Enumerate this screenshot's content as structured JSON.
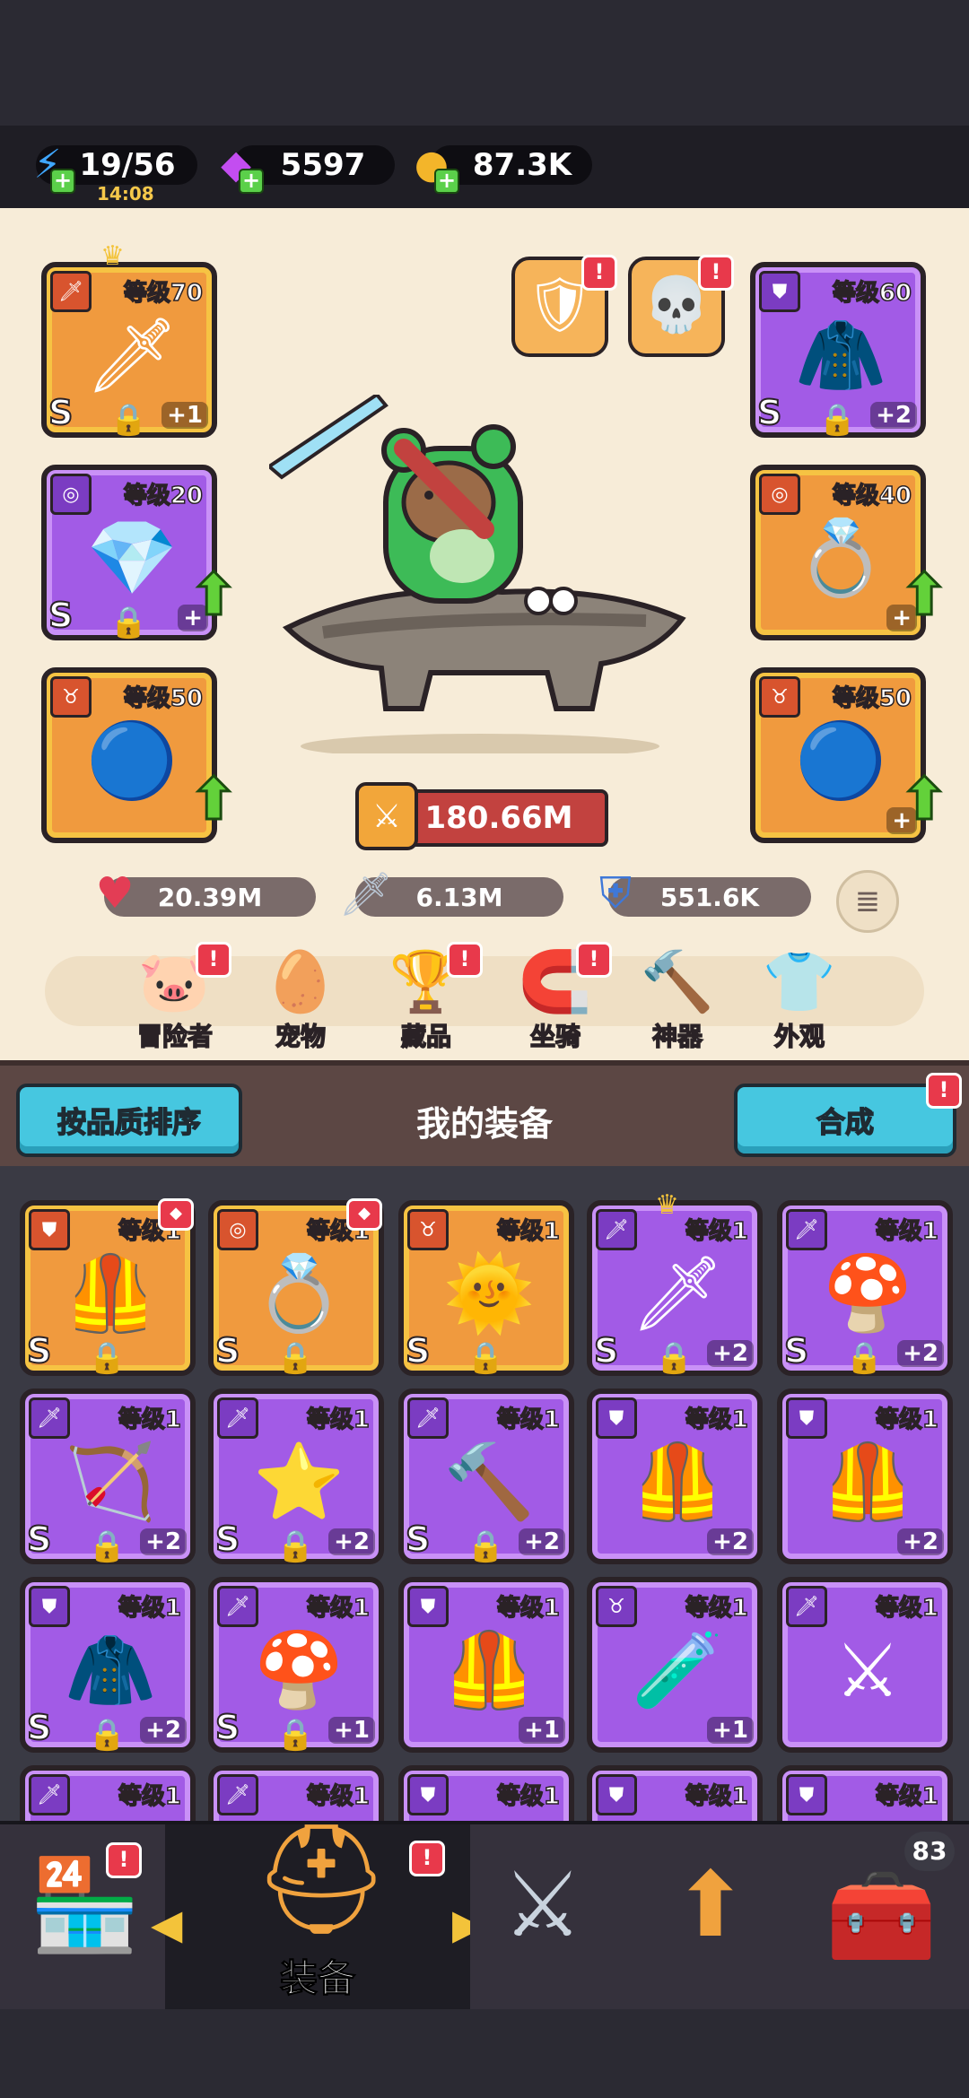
{
  "resources": {
    "energy": "19/56",
    "energy_timer": "14:08",
    "gems": "5597",
    "gold": "87.3K"
  },
  "hero": {
    "slots_left": [
      {
        "level": "等级70",
        "grade": "S",
        "plus": "+1",
        "rarity": "orange",
        "type_icon": "sword-icon",
        "art": "dark-sword"
      },
      {
        "level": "等级20",
        "grade": "S",
        "plus": "+",
        "rarity": "purple",
        "type_icon": "ring-icon",
        "art": "crystal-bracer"
      },
      {
        "level": "等级50",
        "grade": "",
        "plus": "",
        "rarity": "orange",
        "type_icon": "necklace-icon",
        "art": "blue-orb"
      }
    ],
    "slots_right": [
      {
        "level": "等级60",
        "grade": "S",
        "plus": "+2",
        "rarity": "purple",
        "type_icon": "armor-icon",
        "art": "purple-cape"
      },
      {
        "level": "等级40",
        "grade": "",
        "plus": "+",
        "rarity": "orange",
        "type_icon": "ring-icon",
        "art": "gold-ring"
      },
      {
        "level": "等级50",
        "grade": "",
        "plus": "+",
        "rarity": "orange",
        "type_icon": "necklace-icon",
        "art": "blue-orb"
      }
    ],
    "power": "180.66M",
    "hp": "20.39M",
    "attack": "6.13M",
    "defense": "551.6K"
  },
  "nav": [
    {
      "label": "冒险者",
      "icon": "pig-adventurer-icon",
      "badge": "!"
    },
    {
      "label": "宠物",
      "icon": "egg-pet-icon",
      "badge": ""
    },
    {
      "label": "藏品",
      "icon": "trophy-icon",
      "badge": "!"
    },
    {
      "label": "坐骑",
      "icon": "horseshoe-icon",
      "badge": "!"
    },
    {
      "label": "神器",
      "icon": "hammer-icon",
      "badge": ""
    },
    {
      "label": "外观",
      "icon": "outfit-icon",
      "badge": ""
    }
  ],
  "equipment": {
    "sort_label": "按品质排序",
    "title": "我的装备",
    "merge_label": "合成",
    "merge_badge": "!",
    "items": [
      {
        "level": "等级1",
        "grade": "S",
        "plus": "",
        "rarity": "orange",
        "type_icon": "armor-icon",
        "art": "leather-vest",
        "locked": true
      },
      {
        "level": "等级1",
        "grade": "S",
        "plus": "",
        "rarity": "orange",
        "type_icon": "ring-icon",
        "art": "purple-ring",
        "locked": true
      },
      {
        "level": "等级1",
        "grade": "S",
        "plus": "",
        "rarity": "orange",
        "type_icon": "necklace-icon",
        "art": "sun-amulet",
        "locked": true
      },
      {
        "level": "等级1",
        "grade": "S",
        "plus": "+2",
        "rarity": "purple",
        "type_icon": "sword-icon",
        "art": "dark-sword",
        "locked": true
      },
      {
        "level": "等级1",
        "grade": "S",
        "plus": "+2",
        "rarity": "purple",
        "type_icon": "sword-icon",
        "art": "mushroom-staff",
        "locked": true
      },
      {
        "level": "等级1",
        "grade": "S",
        "plus": "+2",
        "rarity": "purple",
        "type_icon": "sword-icon",
        "art": "bow",
        "locked": true
      },
      {
        "level": "等级1",
        "grade": "S",
        "plus": "+2",
        "rarity": "purple",
        "type_icon": "sword-icon",
        "art": "star-wand",
        "locked": true
      },
      {
        "level": "等级1",
        "grade": "S",
        "plus": "+2",
        "rarity": "purple",
        "type_icon": "sword-icon",
        "art": "golden-mace",
        "locked": true
      },
      {
        "level": "等级1",
        "grade": "",
        "plus": "+2",
        "rarity": "purple",
        "type_icon": "armor-icon",
        "art": "leather-vest",
        "locked": false
      },
      {
        "level": "等级1",
        "grade": "",
        "plus": "+2",
        "rarity": "purple",
        "type_icon": "armor-icon",
        "art": "leather-vest",
        "locked": false
      },
      {
        "level": "等级1",
        "grade": "S",
        "plus": "+2",
        "rarity": "purple",
        "type_icon": "armor-icon",
        "art": "purple-cape",
        "locked": true
      },
      {
        "level": "等级1",
        "grade": "S",
        "plus": "+1",
        "rarity": "purple",
        "type_icon": "sword-icon",
        "art": "mushroom-staff",
        "locked": true
      },
      {
        "level": "等级1",
        "grade": "",
        "plus": "+1",
        "rarity": "purple",
        "type_icon": "armor-icon",
        "art": "leather-vest",
        "locked": false
      },
      {
        "level": "等级1",
        "grade": "",
        "plus": "+1",
        "rarity": "purple",
        "type_icon": "necklace-icon",
        "art": "green-amulet",
        "locked": false
      },
      {
        "level": "等级1",
        "grade": "",
        "plus": "",
        "rarity": "purple",
        "type_icon": "sword-icon",
        "art": "steel-sword",
        "locked": false
      },
      {
        "level": "等级1",
        "grade": "",
        "plus": "",
        "rarity": "purple",
        "type_icon": "sword-icon",
        "art": "",
        "locked": false
      },
      {
        "level": "等级1",
        "grade": "",
        "plus": "",
        "rarity": "purple",
        "type_icon": "sword-icon",
        "art": "",
        "locked": false
      },
      {
        "level": "等级1",
        "grade": "",
        "plus": "",
        "rarity": "purple",
        "type_icon": "armor-icon",
        "art": "",
        "locked": false
      },
      {
        "level": "等级1",
        "grade": "",
        "plus": "",
        "rarity": "purple",
        "type_icon": "armor-icon",
        "art": "",
        "locked": false
      },
      {
        "level": "等级1",
        "grade": "",
        "plus": "",
        "rarity": "purple",
        "type_icon": "armor-icon",
        "art": "",
        "locked": false
      }
    ]
  },
  "bottom_nav": {
    "equip_label": "装备",
    "chest_count": "83",
    "shop_badge": "!",
    "equip_badge": "!"
  },
  "colors": {
    "orange": "#f09a3e",
    "purple": "#a25be6",
    "power": "#c2423f",
    "cyan_button": "#46c7e0"
  }
}
